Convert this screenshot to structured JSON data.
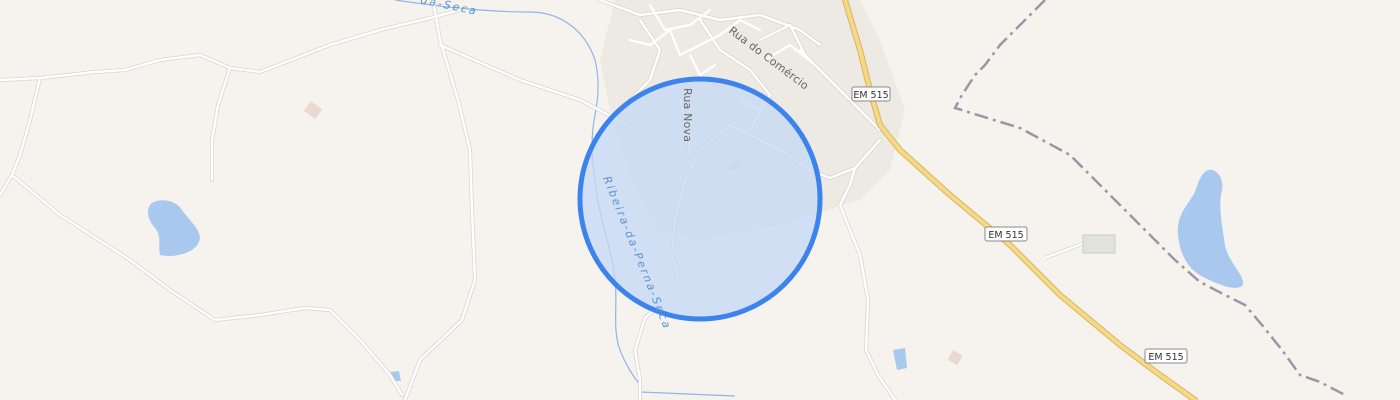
{
  "map": {
    "colors": {
      "land": "#f6f3ef",
      "urban": "#ede9e3",
      "road": "#ffffff",
      "road_casing": "#d9d4cd",
      "main_road": "#f5d98a",
      "main_road_casing": "#d9b55a",
      "water": "#a9c8ee",
      "river": "#8fb6e6",
      "boundary": "#9a95a8",
      "accuracy_fill": "#c4d8f5",
      "accuracy_stroke": "#3d83ee",
      "building": "#e9d9d2"
    },
    "street_labels": {
      "rua_nova": "Rua Nova",
      "rua_do_comercio": "Rua do Comércio"
    },
    "water_labels": {
      "river_main": "Ribeira-da-Perna-Seca",
      "river_top": "da-Seca"
    },
    "road_shields": [
      {
        "label": "EM 515"
      },
      {
        "label": "EM 515"
      },
      {
        "label": "EM 515"
      }
    ],
    "location_marker": "accuracy-circle"
  }
}
